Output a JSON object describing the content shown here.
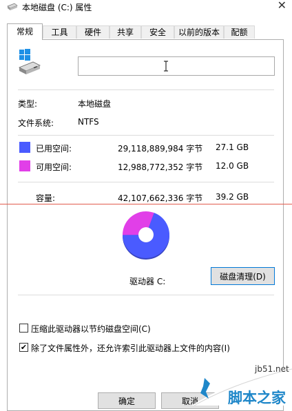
{
  "window": {
    "title": "本地磁盘 (C:) 属性",
    "close_glyph": "✕"
  },
  "tabs": [
    {
      "label": "常规",
      "active": true
    },
    {
      "label": "工具"
    },
    {
      "label": "硬件"
    },
    {
      "label": "共享"
    },
    {
      "label": "安全"
    },
    {
      "label": "以前的版本"
    },
    {
      "label": "配额"
    }
  ],
  "general": {
    "drive_icon": "windows-drive-icon",
    "name_value": "",
    "type_label": "类型:",
    "type_value": "本地磁盘",
    "fs_label": "文件系统:",
    "fs_value": "NTFS",
    "used": {
      "label": "已用空间:",
      "bytes": "29,118,889,984 字节",
      "size": "27.1 GB",
      "color": "#4a5bff"
    },
    "free": {
      "label": "可用空间:",
      "bytes": "12,988,772,352 字节",
      "size": "12.0 GB",
      "color": "#e13fe8"
    },
    "capacity": {
      "label": "容量:",
      "bytes": "42,107,662,336 字节",
      "size": "39.2 GB"
    },
    "drive_label": "驱动器 C:",
    "cleanup_button": "磁盘清理(D)",
    "compress_label": "压缩此驱动器以节约磁盘空间(C)",
    "compress_checked": false,
    "index_label": "除了文件属性外，还允许索引此驱动器上文件的内容(I)",
    "index_checked": true,
    "check_glyph": "✔"
  },
  "chart_data": {
    "type": "pie",
    "categories": [
      "已用空间",
      "可用空间"
    ],
    "values": [
      27.1,
      12.0
    ],
    "colors": [
      "#4a5bff",
      "#e13fe8"
    ]
  },
  "footer": {
    "ok_button": "确定",
    "cancel_button": "取消"
  },
  "watermark": {
    "site": "jb51.net",
    "brand": "脚本之家"
  }
}
